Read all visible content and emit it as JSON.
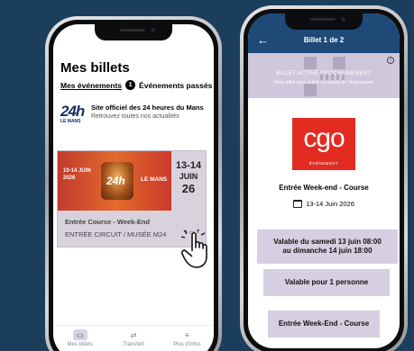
{
  "left_screen": {
    "title": "Mes billets",
    "tabs": [
      {
        "label": "Mes événements",
        "active": true
      },
      {
        "label": "Événements passés",
        "active": false
      }
    ],
    "tab_count": "1",
    "official": {
      "logo_main": "24h",
      "logo_sub": "LE MANS",
      "title": "Site officiel des 24 heures du Mans",
      "subtitle": "Retrouvez toutes nos actualités"
    },
    "ticket": {
      "banner_dates": "10-14 JUIN\n2026",
      "banner_logo": "24h",
      "banner_brand": "LE MANS",
      "date_line1": "13-14",
      "date_line2": "JUIN",
      "date_line3": "26",
      "name": "Entrée Course - Week-End",
      "subtitle": "ENTRÉE CIRCUIT /  MUSÉE M24",
      "count": "1 ▭ ›"
    },
    "nav": [
      {
        "label": "Mes billets",
        "icon": "ticket-icon",
        "active": true
      },
      {
        "label": "Transfert",
        "icon": "transfer-icon",
        "active": false
      },
      {
        "label": "Plus d'infos",
        "icon": "menu-icon",
        "active": false
      }
    ]
  },
  "right_screen": {
    "header_title": "Billet 1 de 2",
    "banner_line1": "BILLET ACTIVÉ PROCHAINEMENT",
    "banner_line2": "Votre billet sera activé en amont de l'événement.",
    "logo_text": "cgo",
    "logo_sub": "ÉVÉNEMENT",
    "event_title": "Entrée Week-end - Course",
    "event_date": "13-14 Juin 2026",
    "valid_line1": "Valable du samedi 13 juin 08:00",
    "valid_line2": "au dimanche 14 juin 18:00",
    "persons": "Valable pour 1 personne",
    "entry": "Entrée Week-End - Course"
  },
  "colors": {
    "background": "#1b3e5c",
    "header": "#1f4a78",
    "accent_lavender": "#d6cfe2",
    "logo_red": "#e32b22"
  }
}
